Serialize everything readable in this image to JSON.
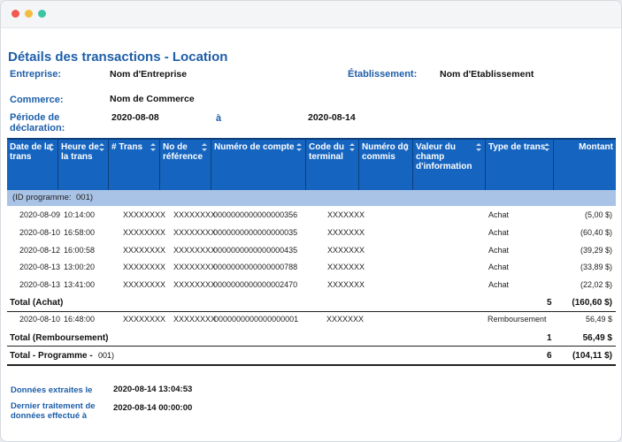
{
  "report": {
    "title": "Détails des transactions - Location",
    "labels": {
      "enterprise": "Entreprise:",
      "establishment": "Établissement:",
      "commerce": "Commerce:",
      "period": "Période de déclaration:",
      "to": "à"
    },
    "values": {
      "enterprise": "Nom d'Entreprise",
      "establishment": "Nom d'Etablissement",
      "commerce": "Nom de Commerce",
      "period_start": "2020-08-08",
      "period_end": "2020-08-14"
    }
  },
  "table": {
    "headers": [
      "Date de la trans",
      "Heure de la trans",
      "# Trans",
      "No de référence",
      "Numéro de compte",
      "Code du terminal",
      "Numéro du commis",
      "Valeur du champ d'information",
      "Type de trans",
      "Montant"
    ],
    "group": {
      "label": "(ID programme:",
      "id": "001)"
    },
    "achat_rows": [
      {
        "date": "2020-08-09",
        "time": "10:14:00",
        "trans": "XXXXXXXX",
        "ref": "XXXXXXXX",
        "account": "0000000000000000356",
        "terminal": "XXXXXXX",
        "type": "Achat",
        "amount": "(5,00 $)"
      },
      {
        "date": "2020-08-10",
        "time": "16:58:00",
        "trans": "XXXXXXXX",
        "ref": "XXXXXXXX",
        "account": "0000000000000000035",
        "terminal": "XXXXXXX",
        "type": "Achat",
        "amount": "(60,40 $)"
      },
      {
        "date": "2020-08-12",
        "time": "16:00:58",
        "trans": "XXXXXXXX",
        "ref": "XXXXXXXX",
        "account": "0000000000000000435",
        "terminal": "XXXXXXX",
        "type": "Achat",
        "amount": "(39,29 $)"
      },
      {
        "date": "2020-08-13",
        "time": "13:00:20",
        "trans": "XXXXXXXX",
        "ref": "XXXXXXXX",
        "account": "0000000000000000788",
        "terminal": "XXXXXXX",
        "type": "Achat",
        "amount": "(33,89 $)"
      },
      {
        "date": "2020-08-13",
        "time": "13:41:00",
        "trans": "XXXXXXXX",
        "ref": "XXXXXXXX",
        "account": "0000000000000002470",
        "terminal": "XXXXXXX",
        "type": "Achat",
        "amount": "(22,02 $)"
      }
    ],
    "total_achat": {
      "label": "Total (Achat)",
      "count": "5",
      "amount": "(160,60 $)"
    },
    "rembo_rows": [
      {
        "date": "2020-08-10",
        "time": "16:48:00",
        "trans": "XXXXXXXX",
        "ref": "XXXXXXXX",
        "account": "0000000000000000001",
        "terminal": "XXXXXXX",
        "type": "Remboursement",
        "amount": "56,49 $"
      }
    ],
    "total_rembo": {
      "label": "Total (Remboursement)",
      "count": "1",
      "amount": "56,49 $"
    },
    "total_program": {
      "label": "Total - Programme -",
      "id": "001)",
      "count": "6",
      "amount": "(104,11 $)"
    }
  },
  "footer": {
    "extracted_label": "Données extraites le",
    "extracted_value": "2020-08-14 13:04:53",
    "last_label": "Dernier traitement de données effectué à",
    "last_value": "2020-08-14 00:00:00"
  }
}
